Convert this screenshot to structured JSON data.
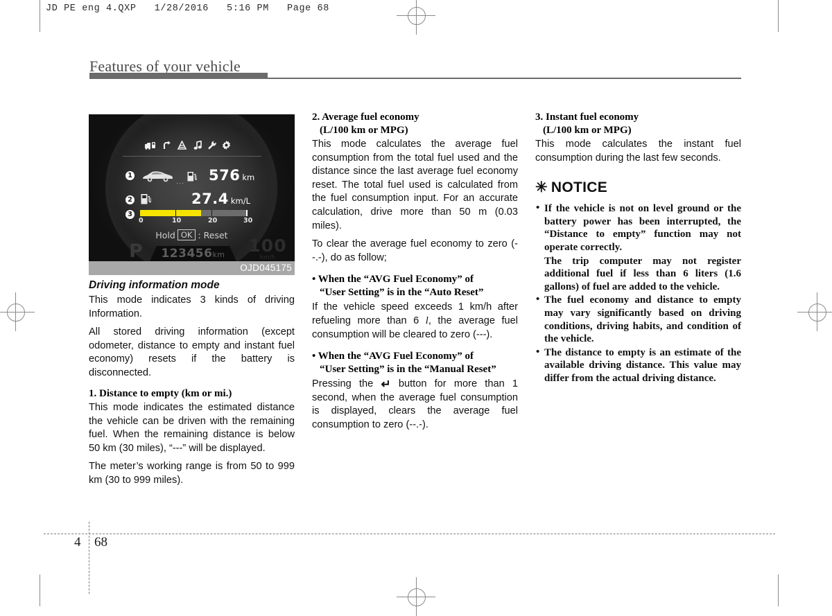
{
  "print_header": "JD PE eng 4.QXP   1/28/2016   5:16 PM   Page 68",
  "running_head": "Features of your vehicle",
  "figure": {
    "caption_code": "OJD045175",
    "icons": [
      "trip-computer-icon",
      "turn-arrow-icon",
      "lane-assist-icon",
      "music-note-icon",
      "wrench-icon",
      "gear-icon"
    ],
    "row1": {
      "badge": "1",
      "value": "576",
      "unit": "km",
      "icons": "car-to-pump"
    },
    "row2": {
      "badge": "2",
      "value": "27.4",
      "unit": "km/L",
      "icons": "fuel-pump"
    },
    "row3": {
      "badge": "3",
      "scale_labels": [
        "0",
        "10",
        "20",
        "30"
      ],
      "scale_min": 0,
      "scale_max": 30,
      "fill_value": 17,
      "fill_color": "#f5e400"
    },
    "hold_reset": {
      "prefix": "Hold",
      "key": "OK",
      "suffix": ": Reset"
    },
    "gear_indicator": "P",
    "odometer": {
      "value": "123456",
      "unit": "km"
    },
    "speed": {
      "value": "100",
      "unit": "km/h"
    }
  },
  "col1": {
    "fig_title": "Driving information mode",
    "p1": "This mode indicates 3 kinds of driving Information.",
    "p2": "All stored driving information (except odometer, distance to empty and instant fuel economy) resets if the battery is disconnected.",
    "h1": "1. Distance to empty (km or mi.)",
    "p3": "This mode indicates the estimated distance the vehicle can be driven with the remaining fuel. When the remaining distance is below 50 km (30 miles), “---” will be displayed.",
    "p4": "The meter’s working range is from 50 to 999 km (30 to 999 miles)."
  },
  "col2": {
    "h1_line1": "2. Average fuel economy",
    "h1_line2": "(L/100 km or MPG)",
    "p1": "This mode calculates the average fuel consumption from the total fuel used and the distance since the last average fuel economy reset. The total fuel used is calculated from the fuel consumption input. For an accurate calculation, drive more than 50 m (0.03 miles).",
    "p2": "To clear the average fuel economy to zero (--.-), do as follow;",
    "b1_line1": "• When the “AVG Fuel Economy” of",
    "b1_line2": "“User Setting” is in the “Auto Reset”",
    "p3_a": "If the vehicle speed exceeds 1 km/h after refueling more than 6 ",
    "p3_lit": "l",
    "p3_b": ", the average fuel consumption will be cleared to zero (---).",
    "b2_line1": "• When the “AVG Fuel Economy” of",
    "b2_line2": "“User Setting” is in the “Manual Reset”",
    "p4_a": "Pressing the ",
    "p4_glyph": "↵",
    "p4_b": " button for more than 1 second, when the average fuel consumption is displayed, clears the average fuel consumption to zero (--.-)."
  },
  "col3": {
    "h1_line1": "3. Instant fuel economy",
    "h1_line2": "(L/100 km or MPG)",
    "p1": "This mode calculates the instant fuel consumption during the last few seconds.",
    "notice_star": "✳",
    "notice_title": "NOTICE",
    "notices": [
      {
        "text": "If the vehicle is not on level ground or the battery power has been interrupted, the “Distance to empty” function may not operate correctly.",
        "sub": "The trip computer may not register additional fuel if less than 6 liters (1.6 gallons) of fuel are added to the vehicle."
      },
      {
        "text": "The fuel economy and distance to empty may vary significantly based on driving conditions, driving habits, and condition of the vehicle.",
        "sub": ""
      },
      {
        "text": "The distance to empty is an estimate of the available driving distance. This value may differ from the actual driving distance.",
        "sub": ""
      }
    ]
  },
  "footer": {
    "chapter": "4",
    "page": "68"
  }
}
